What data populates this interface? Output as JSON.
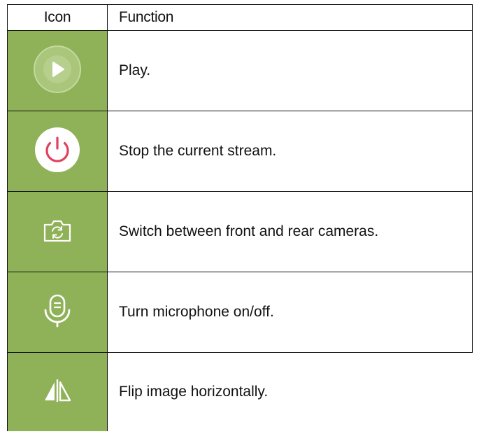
{
  "table": {
    "headers": {
      "icon": "Icon",
      "function": "Function"
    },
    "rows": [
      {
        "icon": "play-icon",
        "description": "Play."
      },
      {
        "icon": "power-stop-icon",
        "description": "Stop the current stream."
      },
      {
        "icon": "switch-camera-icon",
        "description": "Switch between front and rear cameras."
      },
      {
        "icon": "microphone-icon",
        "description": "Turn microphone on/off."
      },
      {
        "icon": "flip-horizontal-icon",
        "description": "Flip image horizontally."
      }
    ]
  },
  "colors": {
    "icon_cell_background": "#8fb157",
    "stop_icon_accent": "#e0415e"
  }
}
